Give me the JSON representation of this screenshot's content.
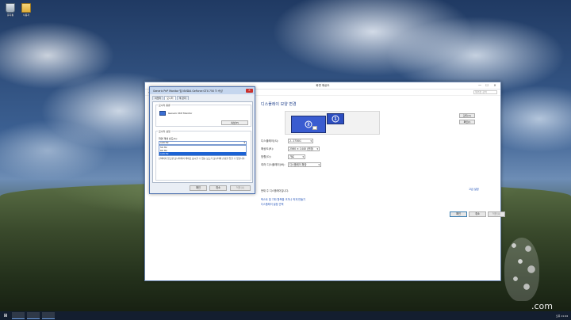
{
  "desktop": {
    "icons": [
      {
        "label": "휴지통",
        "icon": "recycle-bin-icon"
      },
      {
        "label": "사용자",
        "icon": "folder-icon"
      }
    ]
  },
  "main_window": {
    "title": "화면 해상도",
    "controls": {
      "minimize": "—",
      "maximize": "☐",
      "close": "✕"
    },
    "nav": {
      "back": "←",
      "forward": "→",
      "up": "↑",
      "search_placeholder": "제어판 검색"
    },
    "heading": "디스플레이 모양 변경",
    "preview": {
      "monitor2_number": "2",
      "monitor1_number": "1"
    },
    "detect_button": "감지(C)",
    "identify_button": "확인(I)",
    "fields": {
      "display_label": "디스플레이(S):",
      "display_value": "2. 2730G",
      "resolution_label": "해상도(R):",
      "resolution_value": "2560 × 1440 (권장)",
      "orientation_label": "방향(O):",
      "orientation_value": "가로",
      "multi_label": "여러 디스플레이(M):",
      "multi_value": "디스플레이 확장"
    },
    "current_text": "현재 주 디스플레이입니다.",
    "advanced_link": "고급 설정",
    "link1": "텍스트 및 기타 항목을 크거나 작게 만들기",
    "link2": "디스플레이 설정 선택",
    "ok": "확인",
    "cancel": "취소",
    "apply": "적용(A)"
  },
  "props_dialog": {
    "title": "Generic PnP Monitor 및 NVIDIA GeForce GTX 750 Ti 속성",
    "close": "✕",
    "tabs": [
      "어댑터",
      "모니터",
      "색 관리"
    ],
    "active_tab": 1,
    "monitor_type_title": "모니터 종류",
    "monitor_name": "Generic PnP Monitor",
    "properties_button": "속성(P)",
    "settings_title": "모니터 설정",
    "refresh_label": "화면 재생 빈도(S):",
    "refresh_selected": "120 Hz",
    "refresh_options": [
      "59 Hz",
      "60 Hz",
      "120 Hz"
    ],
    "selected_option_index": 2,
    "warning": "선택하지 않으면 모니터에서 제대로 표시할 수 없는 모드가 모니터에 손상을 입힐 수 있습니다.",
    "ok": "확인",
    "cancel": "취소",
    "apply": "적용(A)"
  },
  "taskbar": {
    "start_glyph": "⊞",
    "tray_time": "오후 11:44"
  },
  "watermark": {
    "text": ".com"
  }
}
